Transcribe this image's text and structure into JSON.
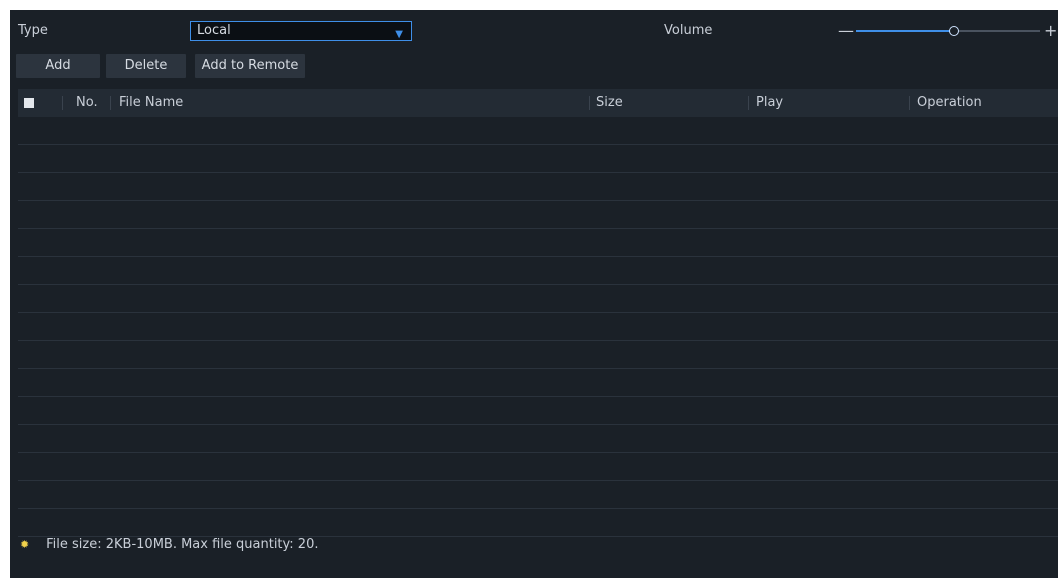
{
  "filters": {
    "type_label": "Type",
    "type_value": "Local",
    "volume_label": "Volume",
    "volume_level_percent": 53
  },
  "toolbar": {
    "add_label": "Add",
    "delete_label": "Delete",
    "add_to_remote_label": "Add to Remote"
  },
  "table": {
    "columns": {
      "no": "No.",
      "file_name": "File Name",
      "size": "Size",
      "play": "Play",
      "operation": "Operation"
    },
    "rows": []
  },
  "footer": {
    "hint_icon": "bulb-icon",
    "hint_text": "File size: 2KB-10MB. Max file quantity: 20."
  },
  "colors": {
    "panel_background": "#1a2027",
    "accent_blue": "#3f8fe8",
    "hint_icon_yellow": "#f2d24b"
  }
}
